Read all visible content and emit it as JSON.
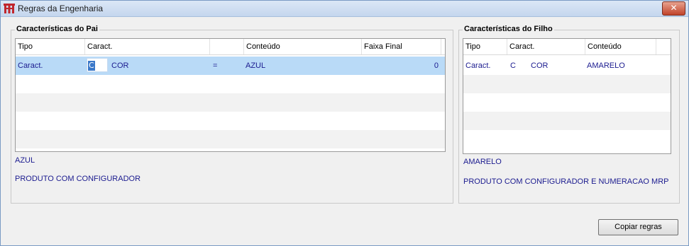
{
  "window": {
    "title": "Regras da Engenharia",
    "close_glyph": "✕"
  },
  "parent": {
    "title": "Características do Pai",
    "columns": [
      "Tipo",
      "Caract.",
      "",
      "Conteúdo",
      "Faixa Final"
    ],
    "rows": [
      {
        "tipo": "Caract.",
        "caract_code": "C",
        "caract_name": "COR",
        "op": "=",
        "conteudo": "AZUL",
        "faixa_final": "0"
      }
    ],
    "content_desc": "AZUL",
    "product_desc": "PRODUTO COM CONFIGURADOR"
  },
  "child": {
    "title": "Características do Filho",
    "columns": [
      "Tipo",
      "Caract.",
      "Conteúdo"
    ],
    "rows": [
      {
        "tipo": "Caract.",
        "caract_code": "C",
        "caract_name": "COR",
        "conteudo": "AMARELO"
      }
    ],
    "content_desc": "AMARELO",
    "product_desc": "PRODUTO COM CONFIGURADOR E NUMERACAO MRP"
  },
  "buttons": {
    "copy_rules": "Copiar regras"
  },
  "colors": {
    "selection": "#b9daf7",
    "value_text": "#1b1b8f",
    "close_button": "#c1432a"
  },
  "icons": {
    "app": "app-logo-icon",
    "close": "close-icon"
  }
}
